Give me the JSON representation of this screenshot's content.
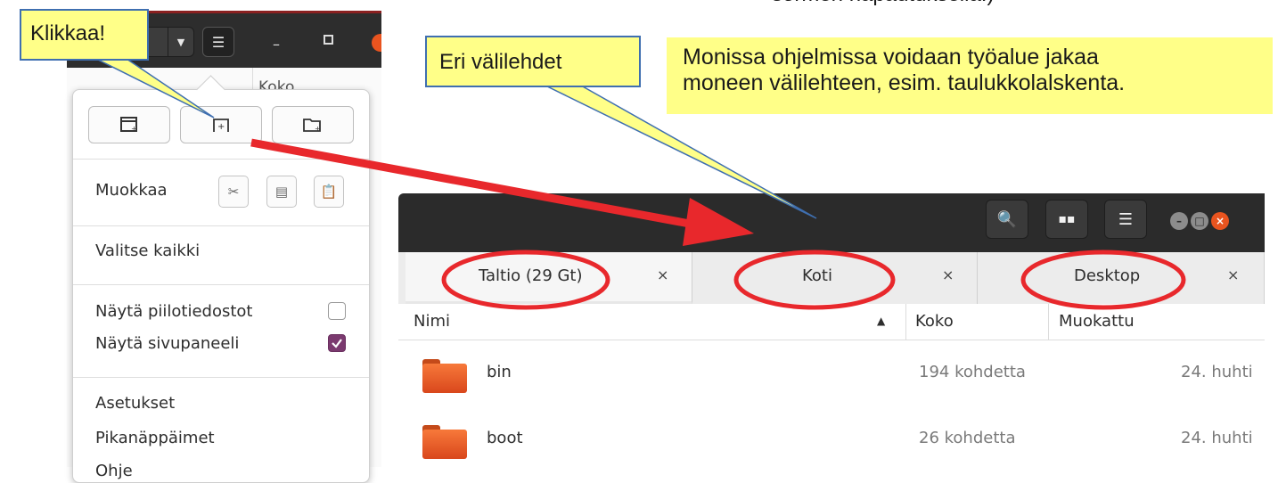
{
  "annotations": {
    "top_cut_text": "sormen napautuksella.)",
    "klikkaa": "Klikkaa!",
    "tabs_label": "Eri välilehdet",
    "info_line1": "Monissa ohjelmissa voidaan työalue jakaa",
    "info_line2": "moneen välilehteen, esim. taulukkolalskenta."
  },
  "colors": {
    "callout_fill": "#ffff88",
    "callout_border": "#3f6fb0",
    "highlight_red": "#e8282c",
    "folder_orange": "#e85d24",
    "checkbox_checked": "#7b3a6f"
  },
  "left_app": {
    "header_icons": [
      "view-toggle-icon",
      "chevron-down-icon",
      "hamburger-menu-icon",
      "minimize-icon",
      "maximize-icon",
      "close-icon"
    ],
    "background_column": "Koko"
  },
  "menu": {
    "top_buttons": [
      {
        "icon": "new-window-icon"
      },
      {
        "icon": "new-tab-icon"
      },
      {
        "icon": "new-folder-icon"
      }
    ],
    "edit_label": "Muokkaa",
    "edit_icons": [
      "cut-icon",
      "copy-icon",
      "paste-icon"
    ],
    "select_all": "Valitse kaikki",
    "show_hidden": "Näytä piilotiedostot",
    "show_hidden_checked": false,
    "show_sidebar": "Näytä sivupaneeli",
    "show_sidebar_checked": true,
    "preferences": "Asetukset",
    "shortcuts": "Pikanäppäimet",
    "help_partial": "Ohje"
  },
  "file_manager": {
    "header_icons": [
      "search-icon",
      "grid-view-icon",
      "hamburger-menu-icon"
    ],
    "tabs": [
      {
        "label": "Taltio (29 Gt)",
        "close": "×"
      },
      {
        "label": "Koti",
        "close": "×"
      },
      {
        "label": "Desktop",
        "close": "×"
      }
    ],
    "columns": {
      "name": "Nimi",
      "size": "Koko",
      "modified": "Muokattu"
    },
    "sort_indicator": "▲",
    "rows": [
      {
        "name": "bin",
        "size": "194 kohdetta",
        "modified": "24. huhti"
      },
      {
        "name": "boot",
        "size": "26 kohdetta",
        "modified": "24. huhti"
      }
    ]
  }
}
